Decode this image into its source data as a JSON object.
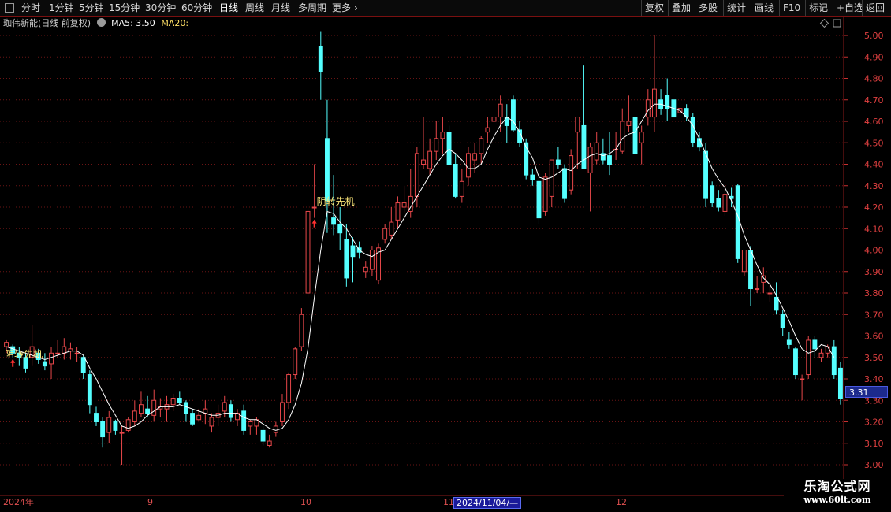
{
  "toolbar": {
    "left_items": [
      {
        "label": "分时",
        "active": false
      },
      {
        "label": "1分钟",
        "active": false
      },
      {
        "label": "5分钟",
        "active": false
      },
      {
        "label": "15分钟",
        "active": false
      },
      {
        "label": "30分钟",
        "active": false
      },
      {
        "label": "60分钟",
        "active": false
      },
      {
        "label": "日线",
        "active": true
      },
      {
        "label": "周线",
        "active": false
      },
      {
        "label": "月线",
        "active": false
      },
      {
        "label": "多周期",
        "active": false
      },
      {
        "label": "更多",
        "active": false
      }
    ],
    "right_items": [
      "复权",
      "叠加",
      "多股",
      "统计",
      "画线",
      "F10",
      "标记",
      "+自选",
      "返回"
    ]
  },
  "legend": {
    "title": "珈伟新能(日线 前复权)",
    "ma5": "MA5: 3.50",
    "ma20": "MA20:"
  },
  "colors": {
    "up": "#e8474a",
    "down": "#54ffff",
    "ma5": "#ffffff",
    "grid": "#6a1414",
    "signal": "#ffe97a"
  },
  "price_axis": {
    "labels": [
      "5.00",
      "4.90",
      "4.80",
      "4.70",
      "4.60",
      "4.50",
      "4.40",
      "4.30",
      "4.20",
      "4.10",
      "4.00",
      "3.90",
      "3.80",
      "3.70",
      "3.60",
      "3.50",
      "3.40",
      "3.30",
      "3.20",
      "3.10",
      "3.00"
    ],
    "current": "3.31"
  },
  "date_axis": {
    "labels": [
      "2024年",
      "9",
      "10",
      "11",
      "2024/11/04/—",
      "12"
    ]
  },
  "signals": [
    "阴转先机",
    "阴转先机"
  ],
  "watermark": {
    "title": "乐淘公式网",
    "url": "www.60lt.com"
  },
  "chart_data": {
    "type": "candlestick",
    "ylim": [
      3.0,
      5.0
    ],
    "ohlc": [
      [
        3.55,
        3.58,
        3.52,
        3.57
      ],
      [
        3.55,
        3.56,
        3.5,
        3.52
      ],
      [
        3.52,
        3.55,
        3.46,
        3.5
      ],
      [
        3.5,
        3.52,
        3.43,
        3.45
      ],
      [
        3.5,
        3.65,
        3.46,
        3.55
      ],
      [
        3.52,
        3.54,
        3.47,
        3.49
      ],
      [
        3.48,
        3.52,
        3.44,
        3.46
      ],
      [
        3.47,
        3.55,
        3.4,
        3.52
      ],
      [
        3.52,
        3.58,
        3.5,
        3.52
      ],
      [
        3.52,
        3.59,
        3.49,
        3.55
      ],
      [
        3.53,
        3.57,
        3.49,
        3.54
      ],
      [
        3.52,
        3.55,
        3.48,
        3.52
      ],
      [
        3.5,
        3.51,
        3.4,
        3.43
      ],
      [
        3.42,
        3.44,
        3.24,
        3.28
      ],
      [
        3.24,
        3.27,
        3.18,
        3.2
      ],
      [
        3.2,
        3.22,
        3.08,
        3.13
      ],
      [
        3.15,
        3.25,
        3.1,
        3.22
      ],
      [
        3.2,
        3.21,
        3.14,
        3.16
      ],
      [
        3.15,
        3.18,
        3.0,
        3.15
      ],
      [
        3.16,
        3.22,
        3.15,
        3.21
      ],
      [
        3.2,
        3.3,
        3.18,
        3.25
      ],
      [
        3.24,
        3.34,
        3.22,
        3.28
      ],
      [
        3.26,
        3.32,
        3.22,
        3.24
      ],
      [
        3.23,
        3.35,
        3.2,
        3.3
      ],
      [
        3.26,
        3.31,
        3.22,
        3.27
      ],
      [
        3.26,
        3.32,
        3.2,
        3.28
      ],
      [
        3.28,
        3.33,
        3.25,
        3.31
      ],
      [
        3.31,
        3.34,
        3.28,
        3.29
      ],
      [
        3.29,
        3.3,
        3.2,
        3.24
      ],
      [
        3.24,
        3.26,
        3.18,
        3.19
      ],
      [
        3.21,
        3.26,
        3.2,
        3.23
      ],
      [
        3.24,
        3.3,
        3.19,
        3.26
      ],
      [
        3.18,
        3.24,
        3.15,
        3.22
      ],
      [
        3.22,
        3.28,
        3.18,
        3.24
      ],
      [
        3.25,
        3.32,
        3.22,
        3.29
      ],
      [
        3.28,
        3.3,
        3.2,
        3.22
      ],
      [
        3.21,
        3.26,
        3.18,
        3.24
      ],
      [
        3.25,
        3.28,
        3.14,
        3.16
      ],
      [
        3.18,
        3.21,
        3.14,
        3.2
      ],
      [
        3.18,
        3.22,
        3.14,
        3.21
      ],
      [
        3.16,
        3.18,
        3.09,
        3.11
      ],
      [
        3.09,
        3.14,
        3.08,
        3.11
      ],
      [
        3.15,
        3.2,
        3.13,
        3.18
      ],
      [
        3.2,
        3.33,
        3.18,
        3.29
      ],
      [
        3.29,
        3.43,
        3.26,
        3.42
      ],
      [
        3.42,
        3.55,
        3.4,
        3.54
      ],
      [
        3.55,
        3.73,
        3.53,
        3.7
      ],
      [
        3.8,
        4.21,
        3.78,
        4.18
      ],
      [
        4.2,
        4.4,
        4.15,
        4.2
      ],
      [
        4.95,
        5.02,
        4.7,
        4.83
      ],
      [
        4.52,
        4.7,
        4.08,
        4.23
      ],
      [
        4.15,
        4.35,
        4.07,
        4.12
      ],
      [
        4.12,
        4.2,
        4.0,
        4.08
      ],
      [
        4.05,
        4.12,
        3.83,
        3.87
      ],
      [
        4.02,
        4.06,
        3.85,
        3.97
      ],
      [
        4.01,
        4.04,
        3.96,
        3.99
      ],
      [
        3.9,
        3.95,
        3.87,
        3.92
      ],
      [
        3.91,
        4.02,
        3.88,
        4.0
      ],
      [
        3.86,
        4.03,
        3.84,
        4.01
      ],
      [
        4.05,
        4.12,
        4.03,
        4.1
      ],
      [
        4.07,
        4.2,
        4.05,
        4.13
      ],
      [
        4.14,
        4.25,
        4.1,
        4.22
      ],
      [
        4.2,
        4.3,
        4.17,
        4.22
      ],
      [
        4.18,
        4.38,
        4.15,
        4.25
      ],
      [
        4.25,
        4.48,
        4.2,
        4.45
      ],
      [
        4.4,
        4.62,
        4.38,
        4.42
      ],
      [
        4.38,
        4.52,
        4.35,
        4.46
      ],
      [
        4.46,
        4.6,
        4.42,
        4.52
      ],
      [
        4.52,
        4.62,
        4.45,
        4.55
      ],
      [
        4.55,
        4.58,
        4.4,
        4.4
      ],
      [
        4.4,
        4.45,
        4.24,
        4.25
      ],
      [
        4.25,
        4.38,
        4.22,
        4.32
      ],
      [
        4.34,
        4.48,
        4.3,
        4.45
      ],
      [
        4.42,
        4.5,
        4.36,
        4.45
      ],
      [
        4.45,
        4.53,
        4.4,
        4.52
      ],
      [
        4.55,
        4.62,
        4.5,
        4.57
      ],
      [
        4.6,
        4.85,
        4.58,
        4.62
      ],
      [
        4.62,
        4.72,
        4.55,
        4.68
      ],
      [
        4.62,
        4.68,
        4.5,
        4.58
      ],
      [
        4.7,
        4.72,
        4.55,
        4.56
      ],
      [
        4.56,
        4.6,
        4.48,
        4.5
      ],
      [
        4.5,
        4.52,
        4.33,
        4.35
      ],
      [
        4.35,
        4.38,
        4.3,
        4.33
      ],
      [
        4.32,
        4.35,
        4.12,
        4.15
      ],
      [
        4.18,
        4.36,
        4.16,
        4.34
      ],
      [
        4.25,
        4.4,
        4.2,
        4.42
      ],
      [
        4.42,
        4.48,
        4.38,
        4.4
      ],
      [
        4.38,
        4.4,
        4.22,
        4.24
      ],
      [
        4.28,
        4.47,
        4.26,
        4.44
      ],
      [
        4.55,
        4.57,
        4.38,
        4.62
      ],
      [
        4.58,
        4.86,
        4.4,
        4.38
      ],
      [
        4.36,
        4.5,
        4.18,
        4.48
      ],
      [
        4.42,
        4.55,
        4.4,
        4.5
      ],
      [
        4.45,
        4.52,
        4.4,
        4.42
      ],
      [
        4.44,
        4.55,
        4.35,
        4.4
      ],
      [
        4.47,
        4.55,
        4.42,
        4.47
      ],
      [
        4.46,
        4.66,
        4.45,
        4.6
      ],
      [
        4.58,
        4.72,
        4.55,
        4.6
      ],
      [
        4.62,
        4.62,
        4.45,
        4.45
      ],
      [
        4.5,
        4.58,
        4.4,
        4.55
      ],
      [
        4.62,
        4.75,
        4.58,
        4.7
      ],
      [
        4.62,
        5.0,
        4.55,
        4.75
      ],
      [
        4.7,
        4.75,
        4.63,
        4.66
      ],
      [
        4.72,
        4.8,
        4.6,
        4.66
      ],
      [
        4.7,
        4.7,
        4.62,
        4.62
      ],
      [
        4.64,
        4.7,
        4.55,
        4.66
      ],
      [
        4.66,
        4.68,
        4.6,
        4.62
      ],
      [
        4.62,
        4.64,
        4.48,
        4.5
      ],
      [
        4.52,
        4.55,
        4.46,
        4.48
      ],
      [
        4.46,
        4.5,
        4.2,
        4.24
      ],
      [
        4.3,
        4.32,
        4.2,
        4.22
      ],
      [
        4.24,
        4.28,
        4.18,
        4.2
      ],
      [
        4.18,
        4.3,
        4.16,
        4.26
      ],
      [
        4.25,
        4.29,
        4.2,
        4.24
      ],
      [
        4.3,
        4.31,
        3.94,
        3.96
      ],
      [
        3.9,
        4.0,
        3.88,
        4.0
      ],
      [
        4.0,
        4.02,
        3.74,
        3.82
      ],
      [
        3.82,
        3.88,
        3.8,
        3.82
      ],
      [
        3.85,
        3.92,
        3.8,
        3.88
      ],
      [
        3.8,
        3.85,
        3.76,
        3.8
      ],
      [
        3.78,
        3.85,
        3.7,
        3.72
      ],
      [
        3.7,
        3.72,
        3.6,
        3.64
      ],
      [
        3.58,
        3.62,
        3.54,
        3.56
      ],
      [
        3.54,
        3.55,
        3.4,
        3.42
      ],
      [
        3.4,
        3.42,
        3.3,
        3.4
      ],
      [
        3.42,
        3.6,
        3.4,
        3.58
      ],
      [
        3.58,
        3.6,
        3.5,
        3.54
      ],
      [
        3.5,
        3.54,
        3.48,
        3.52
      ],
      [
        3.52,
        3.56,
        3.5,
        3.55
      ],
      [
        3.55,
        3.58,
        3.4,
        3.42
      ],
      [
        3.45,
        3.48,
        3.28,
        3.31
      ]
    ],
    "ma5": [
      3.55,
      3.54,
      3.53,
      3.52,
      3.51,
      3.5,
      3.49,
      3.5,
      3.51,
      3.52,
      3.53,
      3.53,
      3.51,
      3.45,
      3.4,
      3.34,
      3.28,
      3.23,
      3.18,
      3.17,
      3.18,
      3.2,
      3.23,
      3.25,
      3.27,
      3.27,
      3.27,
      3.28,
      3.27,
      3.26,
      3.25,
      3.24,
      3.23,
      3.23,
      3.24,
      3.24,
      3.24,
      3.22,
      3.21,
      3.21,
      3.19,
      3.17,
      3.16,
      3.17,
      3.21,
      3.28,
      3.38,
      3.54,
      3.78,
      4.0,
      4.18,
      4.17,
      4.13,
      4.1,
      4.05,
      4.0,
      3.98,
      3.97,
      3.99,
      4.0,
      4.05,
      4.1,
      4.15,
      4.2,
      4.25,
      4.3,
      4.35,
      4.4,
      4.44,
      4.47,
      4.45,
      4.42,
      4.38,
      4.38,
      4.4,
      4.47,
      4.53,
      4.58,
      4.62,
      4.6,
      4.55,
      4.48,
      4.43,
      4.34,
      4.33,
      4.34,
      4.36,
      4.38,
      4.37,
      4.4,
      4.42,
      4.44,
      4.45,
      4.44,
      4.45,
      4.47,
      4.52,
      4.54,
      4.55,
      4.6,
      4.65,
      4.68,
      4.68,
      4.67,
      4.66,
      4.65,
      4.62,
      4.58,
      4.52,
      4.45,
      4.38,
      4.33,
      4.29,
      4.23,
      4.16,
      4.07,
      4.0,
      3.93,
      3.87,
      3.84,
      3.79,
      3.73,
      3.67,
      3.6,
      3.54,
      3.52,
      3.53,
      3.56,
      3.55,
      3.5
    ]
  }
}
